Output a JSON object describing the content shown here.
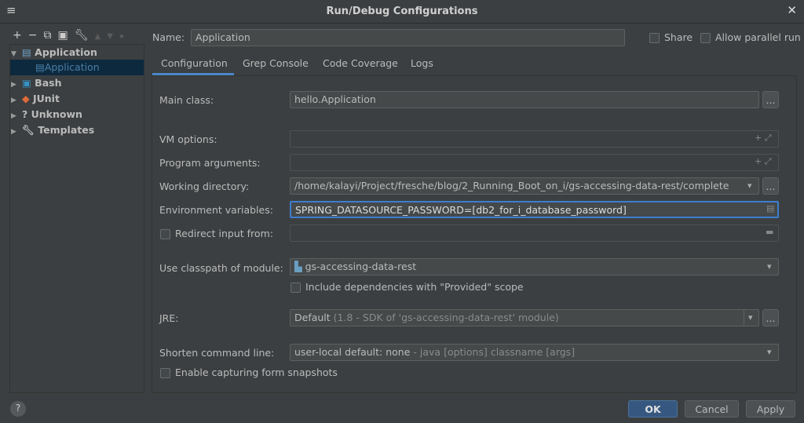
{
  "window": {
    "title": "Run/Debug Configurations",
    "menu_icon": "hamburger-icon",
    "close_icon": "close-icon"
  },
  "toolbar": {
    "icons": [
      "plus-icon",
      "minus-icon",
      "copy-icon",
      "save-icon",
      "wrench-icon",
      "arrow-up-icon",
      "arrow-down-icon",
      "more-icon"
    ]
  },
  "tree": {
    "items": [
      {
        "label": "Application",
        "expanded": true
      },
      {
        "label": "Application",
        "selected": true
      },
      {
        "label": "Bash"
      },
      {
        "label": "JUnit"
      },
      {
        "label": "Unknown"
      },
      {
        "label": "Templates"
      }
    ]
  },
  "name": {
    "label": "Name:",
    "value": "Application"
  },
  "share": {
    "label": "Share",
    "checked": false
  },
  "parallel": {
    "label": "Allow parallel run",
    "checked": false
  },
  "tabs": [
    {
      "label": "Configuration",
      "active": true
    },
    {
      "label": "Grep Console"
    },
    {
      "label": "Code Coverage"
    },
    {
      "label": "Logs"
    }
  ],
  "form": {
    "main_class": {
      "label": "Main class:",
      "value": "hello.Application"
    },
    "vm_options": {
      "label": "VM options:",
      "value": ""
    },
    "program_args": {
      "label": "Program arguments:",
      "value": ""
    },
    "working_dir": {
      "label": "Working directory:",
      "value": "/home/kalayi/Project/fresche/blog/2_Running_Boot_on_i/gs-accessing-data-rest/complete"
    },
    "env_vars": {
      "label": "Environment variables:",
      "value": "SPRING_DATASOURCE_PASSWORD=[db2_for_i_database_password]"
    },
    "redirect": {
      "label": "Redirect input from:",
      "checked": false,
      "value": ""
    },
    "classpath": {
      "label": "Use classpath of module:",
      "value": "gs-accessing-data-rest"
    },
    "include_deps": {
      "label": "Include dependencies with \"Provided\" scope",
      "checked": false
    },
    "jre": {
      "label": "JRE:",
      "value": "Default",
      "hint": "(1.8 - SDK of 'gs-accessing-data-rest' module)"
    },
    "shorten": {
      "label": "Shorten command line:",
      "value": "user-local default: none",
      "hint": "- java [options] classname [args]"
    },
    "snapshots": {
      "label": "Enable capturing form snapshots",
      "checked": false
    },
    "ellipsis": "..."
  },
  "footer": {
    "help": "?",
    "ok": "OK",
    "cancel": "Cancel",
    "apply": "Apply"
  },
  "colors": {
    "accent": "#4a88c7",
    "ok": "#365880",
    "selected": "#0d293e"
  }
}
